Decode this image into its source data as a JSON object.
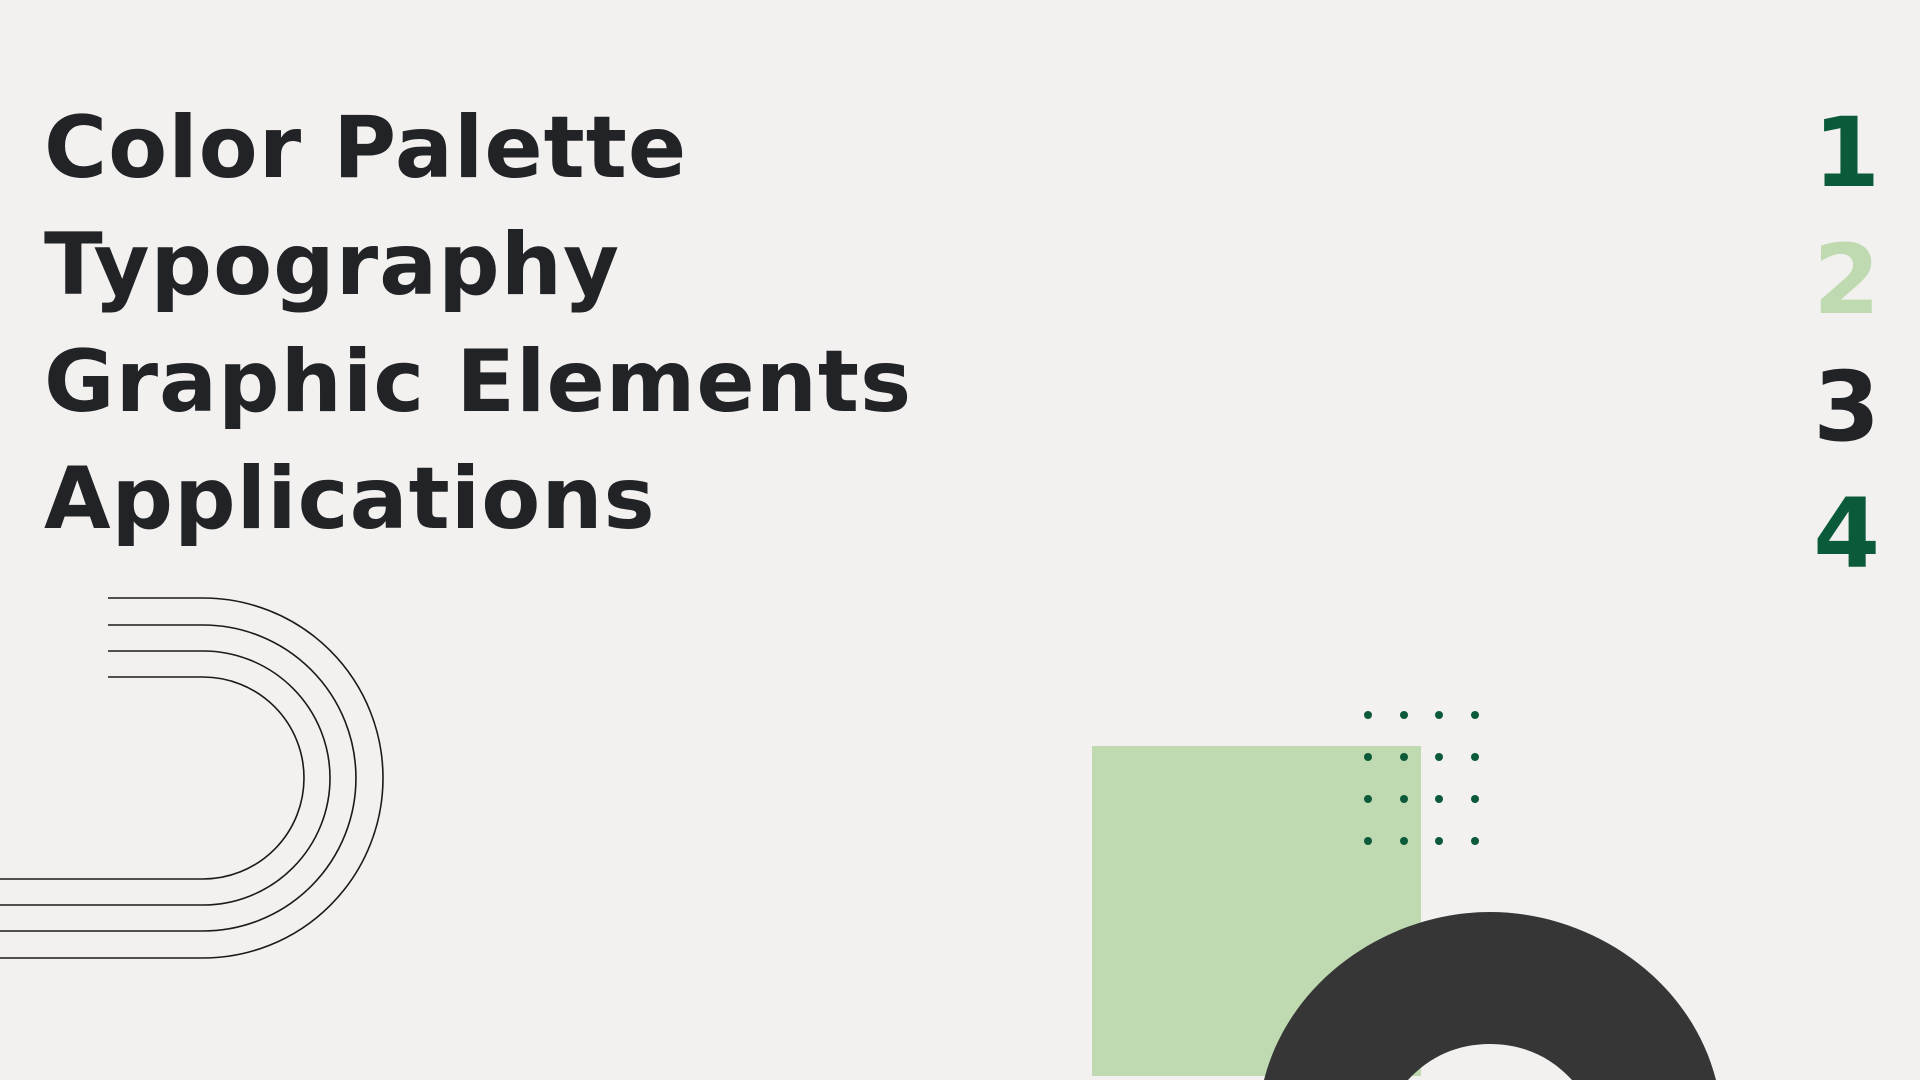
{
  "toc": {
    "items": [
      "Color Palette",
      "Typography",
      "Graphic Elements",
      "Applications"
    ],
    "numbers": [
      "1",
      "2",
      "3",
      "4"
    ]
  },
  "colors": {
    "background": "#f2f1ef",
    "text_dark": "#222326",
    "green_dark": "#0b5a3a",
    "green_light": "#bfdab1",
    "ring_dark": "#363636",
    "line": "#1a1a1a"
  },
  "number_colors": [
    "#0b5a3a",
    "#bfdab1",
    "#222326",
    "#0b5a3a"
  ]
}
